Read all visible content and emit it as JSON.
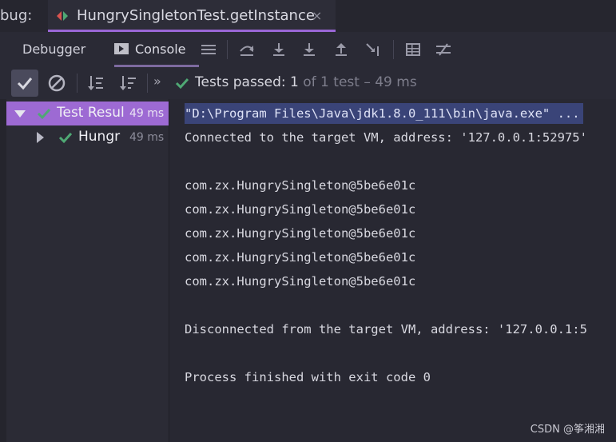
{
  "window": {
    "title_prefix": "bug:",
    "tab_title": "HungrySingletonTest.getInstance",
    "tab_close": "×"
  },
  "toolbar": {
    "debugger_tab": "Debugger",
    "console_tab": "Console",
    "icons": [
      "menu-icon",
      "step-over-icon",
      "step-into-icon",
      "force-step-into-icon",
      "step-out-icon",
      "run-to-cursor-icon",
      "evaluate-icon",
      "trace-icon"
    ]
  },
  "test_toolbar": {
    "more": "»",
    "status_main": "Tests passed: 1",
    "status_detail": " of 1 test – 49 ms"
  },
  "tree": {
    "rows": [
      {
        "label": "Test Resul",
        "time": "49 ms"
      },
      {
        "label": "Hungr",
        "time": "49 ms"
      }
    ]
  },
  "console": {
    "lines": [
      "\"D:\\Program Files\\Java\\jdk1.8.0_111\\bin\\java.exe\" ...",
      "Connected to the target VM, address: '127.0.0.1:52975'",
      "",
      "com.zx.HungrySingleton@5be6e01c",
      "com.zx.HungrySingleton@5be6e01c",
      "com.zx.HungrySingleton@5be6e01c",
      "com.zx.HungrySingleton@5be6e01c",
      "com.zx.HungrySingleton@5be6e01c",
      "",
      "Disconnected from the target VM, address: '127.0.0.1:5",
      "",
      "Process finished with exit code 0"
    ]
  },
  "watermark": "CSDN @筝湘湘",
  "colors": {
    "accent": "#9d6ad3",
    "pass_green": "#4fa874",
    "background": "#282832"
  }
}
